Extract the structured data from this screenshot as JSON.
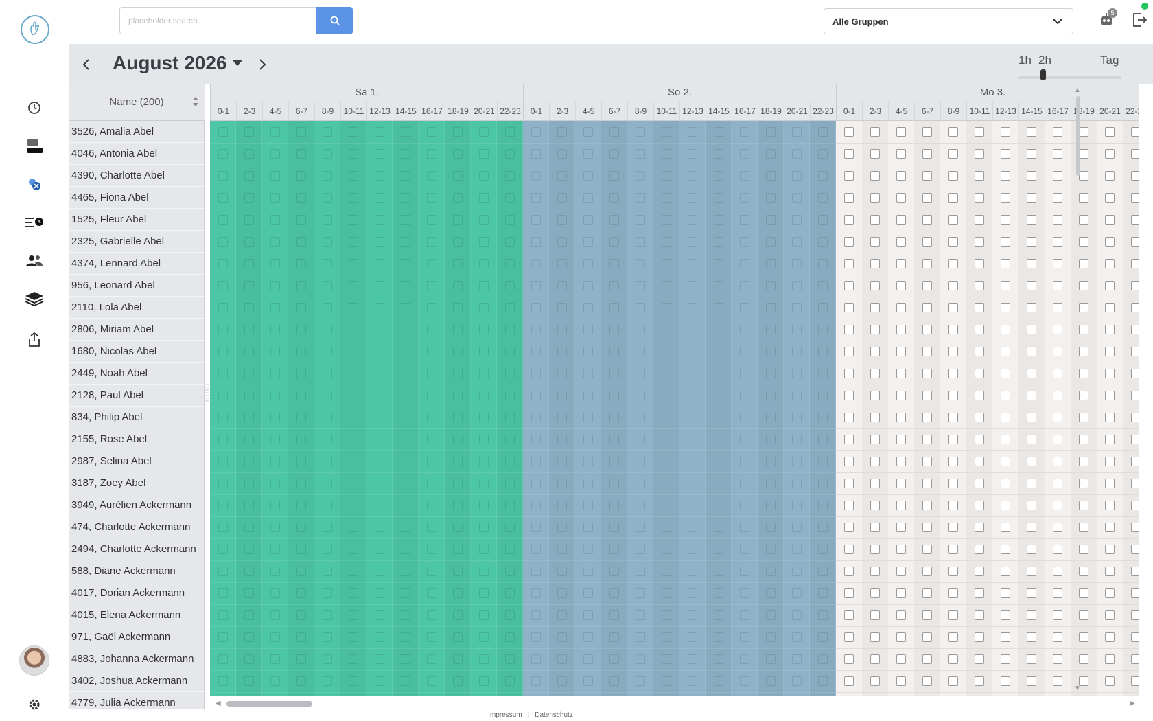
{
  "header": {
    "search_placeholder": "placeholder.search",
    "group_select_value": "Alle Gruppen",
    "notification_count": "5"
  },
  "toolbar": {
    "month_title": "August 2026",
    "zoom_options": [
      "1h",
      "2h",
      "Tag"
    ],
    "zoom_selected": "2h"
  },
  "grid": {
    "name_header": "Name (200)",
    "slots": [
      "0-1",
      "2-3",
      "4-5",
      "6-7",
      "8-9",
      "10-11",
      "12-13",
      "14-15",
      "16-17",
      "18-19",
      "20-21",
      "22-23"
    ],
    "days": [
      {
        "label": "Sa 1.",
        "type": "weekend-sat",
        "color": "#4cc6a5"
      },
      {
        "label": "So 2.",
        "type": "weekend-sun",
        "color": "#8fb2c8"
      },
      {
        "label": "Mo 3.",
        "type": "weekday",
        "color": "#f4f0ed"
      }
    ],
    "names": [
      "3526, Amalia Abel",
      "4046, Antonia Abel",
      "4390, Charlotte Abel",
      "4465, Fiona Abel",
      "1525, Fleur Abel",
      "2325, Gabrielle Abel",
      "4374, Lennard Abel",
      "956, Leonard Abel",
      "2110, Lola Abel",
      "2806, Miriam Abel",
      "1680, Nicolas Abel",
      "2449, Noah Abel",
      "2128, Paul Abel",
      "834, Philip Abel",
      "2155, Rose Abel",
      "2987, Selina Abel",
      "3187, Zoey Abel",
      "3949, Aurélien Ackermann",
      "474, Charlotte Ackermann",
      "2494, Charlotte Ackermann",
      "588, Diane Ackermann",
      "4017, Dorian Ackermann",
      "4015, Elena Ackermann",
      "971, Gaël Ackermann",
      "4883, Johanna Ackermann",
      "3402, Joshua Ackermann",
      "4779, Julia Ackermann"
    ]
  },
  "sidebar": {
    "icons": [
      "logo-icon",
      "history-icon",
      "cards-icon",
      "bug-x-icon",
      "list-clock-icon",
      "users-icon",
      "layers-icon",
      "export-icon",
      "settings-icon"
    ]
  },
  "footer": {
    "impressum": "Impressum",
    "datenschutz": "Datenschutz"
  }
}
